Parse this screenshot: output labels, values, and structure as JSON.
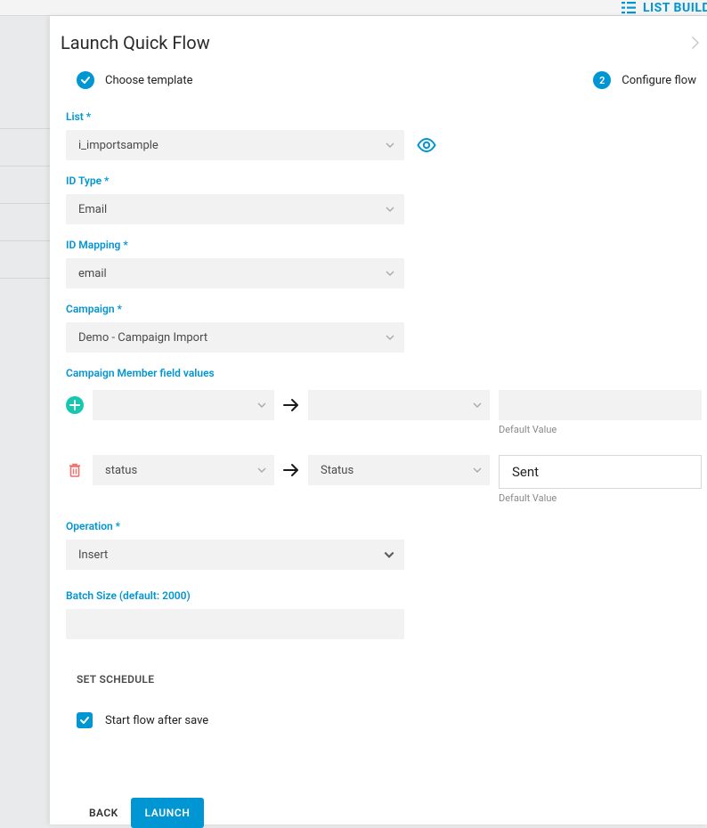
{
  "topbar": {
    "list_build": "LIST BUILD"
  },
  "modal": {
    "title": "Launch Quick Flow",
    "steps": {
      "choose": "Choose template",
      "configure_num": "2",
      "configure": "Configure flow"
    }
  },
  "fields": {
    "list_label": "List *",
    "list_value": "i_importsample",
    "idtype_label": "ID Type *",
    "idtype_value": "Email",
    "idmap_label": "ID Mapping *",
    "idmap_value": "email",
    "campaign_label": "Campaign *",
    "campaign_value": "Demo - Campaign Import",
    "member_label": "Campaign Member field values",
    "default_value_hint": "Default Value",
    "mapping_rows": [
      {
        "source": "",
        "target": "",
        "value": "",
        "kind": "add"
      },
      {
        "source": "status",
        "target": "Status",
        "value": "Sent",
        "kind": "delete"
      }
    ],
    "operation_label": "Operation *",
    "operation_value": "Insert",
    "batch_label": "Batch Size (default: 2000)",
    "batch_value": "",
    "set_schedule": "SET SCHEDULE",
    "start_after_save": "Start flow after save"
  },
  "footer": {
    "back": "BACK",
    "launch": "LAUNCH"
  }
}
